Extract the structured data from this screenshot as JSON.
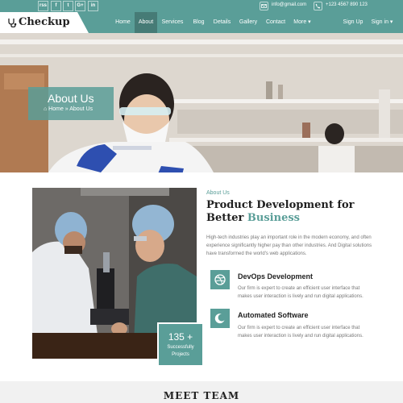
{
  "topbar": {
    "social": [
      "rss-icon",
      "facebook-icon",
      "twitter-icon",
      "google-plus-icon",
      "linkedin-icon"
    ],
    "social_glyphs": [
      "rss",
      "f",
      "t",
      "G+",
      "in"
    ],
    "email": "info@gmail.com",
    "phone": "+123 4567 890 123"
  },
  "brand": {
    "name": "Checkup"
  },
  "nav": {
    "items": [
      "Home",
      "About",
      "Services",
      "Blog",
      "Details",
      "Gallery",
      "Contact",
      "More ▾"
    ],
    "active": "About",
    "signup": "Sign Up",
    "signin": "Sign in ▾"
  },
  "hero": {
    "title": "About Us",
    "breadcrumb": "⌂ Home » About Us"
  },
  "about": {
    "eyebrow": "About Us",
    "heading_line1": "Product Development for",
    "heading_plain": "Better ",
    "heading_accent": "Business",
    "description": "High-tech industries play an important role in the modern economy, and often experience significantly higher pay than other industries. And Digital solutions have transformed the world's web applications.",
    "projects_count": "135 +",
    "projects_label": "Successfully Projects",
    "features": [
      {
        "icon": "dribbble-icon",
        "title": "DevOps Development",
        "text": "Our firm is expert to create an efficient user interface that makes user interaction is lively and run digital applications."
      },
      {
        "icon": "moon-icon",
        "title": "Automated Software",
        "text": "Our firm is expert to create an efficient user interface that makes user interaction is lively and run digital applications."
      }
    ]
  },
  "team": {
    "title": "MEET TEAM"
  },
  "colors": {
    "accent": "#5a9e98",
    "text_dark": "#222222",
    "text_muted": "#777777"
  }
}
